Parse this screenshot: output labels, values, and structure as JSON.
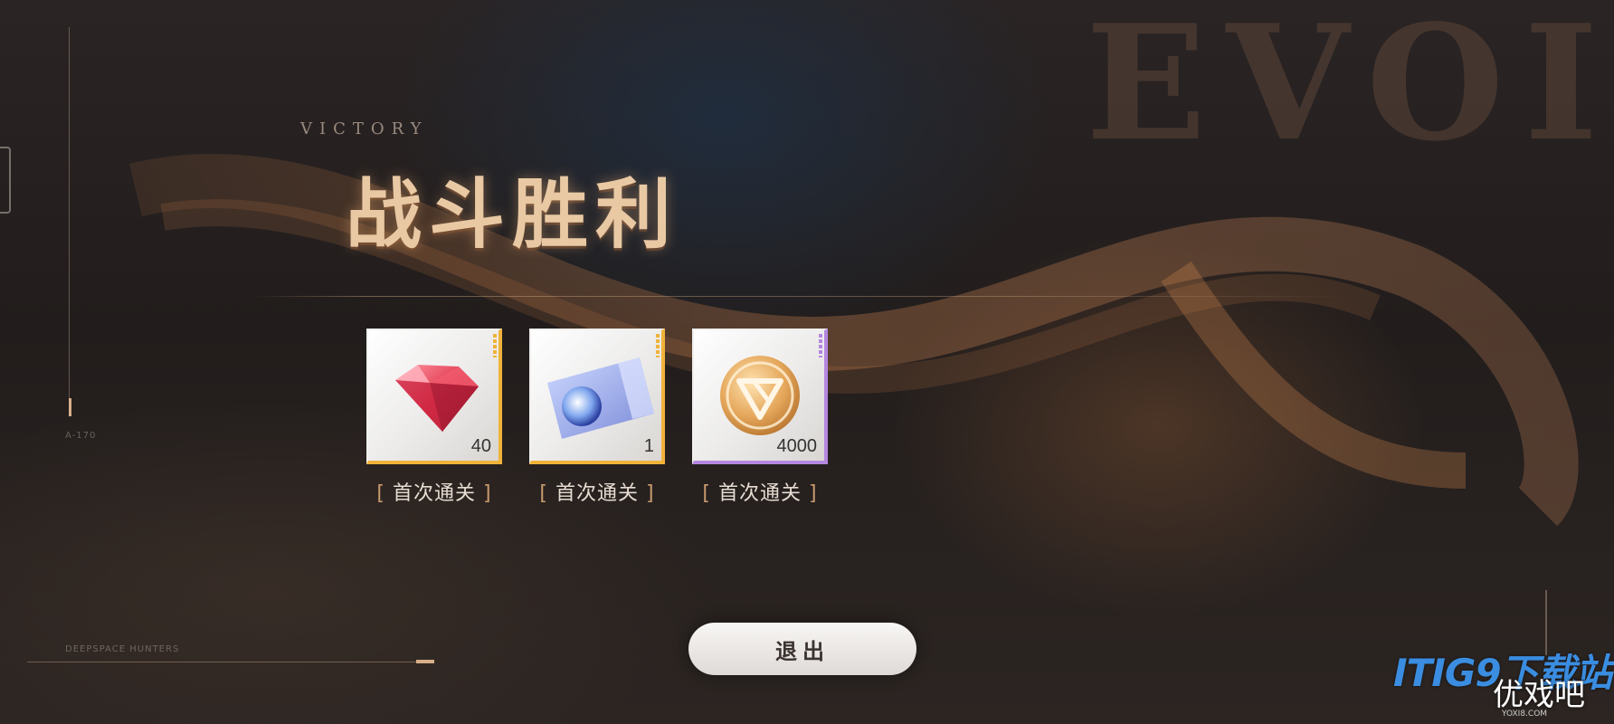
{
  "header": {
    "evo_text": "EVOI",
    "subtitle": "VICTORY",
    "title": "战斗胜利"
  },
  "rewards": [
    {
      "icon": "red-diamond-icon",
      "quantity": "40",
      "rarity_color": "#f0b33a",
      "tag_open": "[",
      "tag": "首次通关",
      "tag_close": "]"
    },
    {
      "icon": "planet-ticket-icon",
      "quantity": "1",
      "rarity_color": "#f0b33a",
      "tag_open": "[",
      "tag": "首次通关",
      "tag_close": "]"
    },
    {
      "icon": "gold-coin-icon",
      "quantity": "4000",
      "rarity_color": "#b487e0",
      "tag_open": "[",
      "tag": "首次通关",
      "tag_close": "]"
    }
  ],
  "footer": {
    "exit_label": "退出",
    "left_caption": "DEEPSPACE HUNTERS",
    "side_code": "A-170"
  },
  "watermark": {
    "logo": "ITIG9下载站",
    "site": "优戏吧",
    "url": "YOXI8.COM"
  }
}
